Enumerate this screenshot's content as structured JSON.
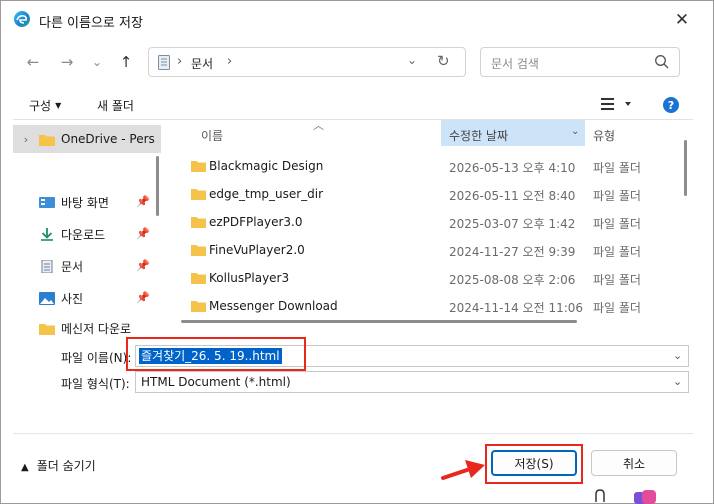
{
  "window": {
    "title": "다른 이름으로 저장",
    "close_glyph": "✕"
  },
  "nav": {
    "back": "←",
    "forward": "→",
    "recent": "⌄",
    "up": "↑"
  },
  "address": {
    "sep": "›",
    "crumb": "문서",
    "dropdown": "⌄",
    "refresh": "↻"
  },
  "search": {
    "placeholder": "문서 검색"
  },
  "toolbar": {
    "organize": "구성",
    "organize_caret": "▼",
    "new_folder": "새 폴더",
    "help": "?"
  },
  "sidebar": {
    "items": [
      {
        "label": "OneDrive - Pers",
        "icon": "folder-icon",
        "selected": true
      },
      {
        "label": "바탕 화면",
        "icon": "desktop-icon"
      },
      {
        "label": "다운로드",
        "icon": "download-icon"
      },
      {
        "label": "문서",
        "icon": "documents-icon"
      },
      {
        "label": "사진",
        "icon": "pictures-icon"
      },
      {
        "label": "메신저 다운로",
        "icon": "folder-icon"
      }
    ]
  },
  "filelist": {
    "columns": {
      "name": "이름",
      "date": "수정한 날짜",
      "type": "유형"
    },
    "rows": [
      {
        "name": "Blackmagic Design",
        "date": "2026-05-13 오후 4:10",
        "type": "파일 폴더"
      },
      {
        "name": "edge_tmp_user_dir",
        "date": "2026-05-11 오전 8:40",
        "type": "파일 폴더"
      },
      {
        "name": "ezPDFPlayer3.0",
        "date": "2025-03-07 오후 1:42",
        "type": "파일 폴더"
      },
      {
        "name": "FineVuPlayer2.0",
        "date": "2024-11-27 오전 9:39",
        "type": "파일 폴더"
      },
      {
        "name": "KollusPlayer3",
        "date": "2025-08-08 오후 2:06",
        "type": "파일 폴더"
      },
      {
        "name": "Messenger Download",
        "date": "2024-11-14 오전 11:06",
        "type": "파일 폴더"
      }
    ]
  },
  "form": {
    "filename_label": "파일 이름(N):",
    "filename_value": "즐겨찾기_26. 5. 19..html",
    "filetype_label": "파일 형식(T):",
    "filetype_value": "HTML Document (*.html)",
    "dropdown": "⌄"
  },
  "footer": {
    "hide_folders": "폴더 숨기기",
    "hide_caret": "▲",
    "save": "저장(S)",
    "cancel": "취소"
  },
  "colors": {
    "accent": "#0067c0",
    "selection": "#0063c9",
    "annotation": "#e8281c",
    "folder": "#f5c34a"
  }
}
